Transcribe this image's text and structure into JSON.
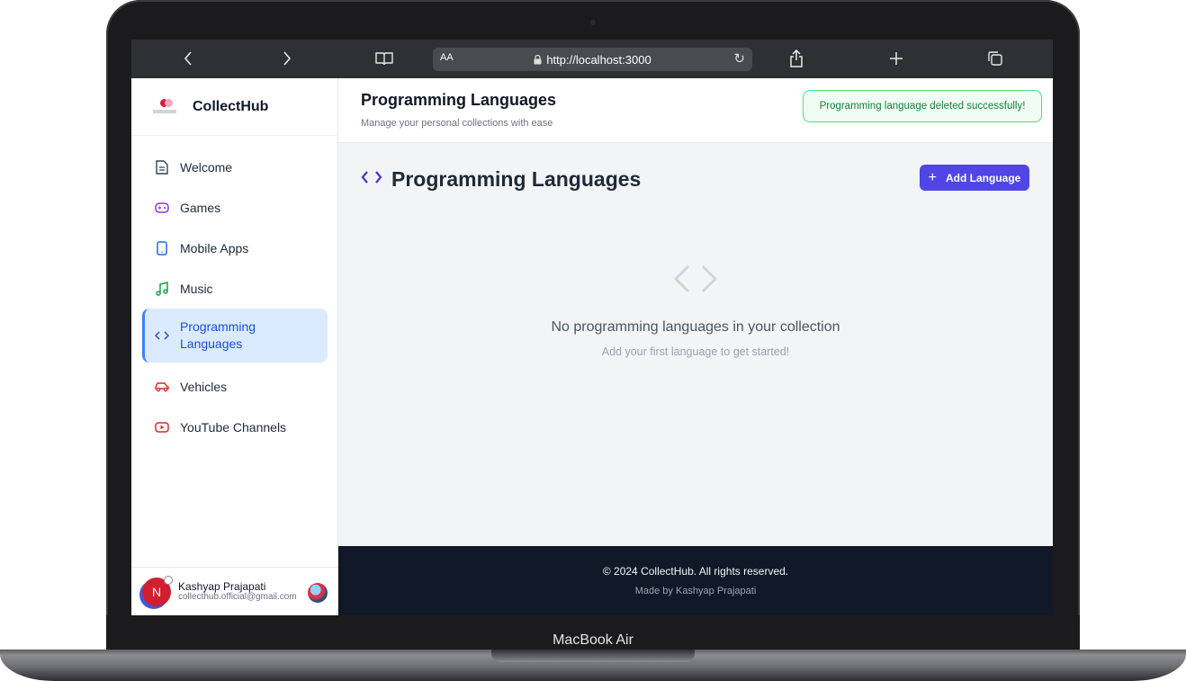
{
  "device": {
    "model_label": "MacBook Air"
  },
  "browser": {
    "reader_label": "AA",
    "url": "http://localhost:3000"
  },
  "app": {
    "brand": "CollectHub",
    "brand_logo_text": "CollectHub",
    "nav": [
      {
        "label": "Welcome",
        "icon": "document-icon",
        "active": false
      },
      {
        "label": "Games",
        "icon": "gamepad-icon",
        "active": false
      },
      {
        "label": "Mobile Apps",
        "icon": "smartphone-icon",
        "active": false
      },
      {
        "label": "Music",
        "icon": "music-note-icon",
        "active": false
      },
      {
        "label": "Programming Languages",
        "icon": "code-icon",
        "active": true
      },
      {
        "label": "Vehicles",
        "icon": "car-icon",
        "active": false
      },
      {
        "label": "YouTube Channels",
        "icon": "youtube-icon",
        "active": false
      }
    ],
    "user": {
      "initial": "N",
      "name": "Kashyap Prajapati",
      "email": "collecthub.official@gmail.com"
    }
  },
  "header": {
    "title": "Programming Languages",
    "subtitle": "Manage your personal collections with ease",
    "toast": "Programming language deleted successfully!"
  },
  "main": {
    "section_title": "Programming Languages",
    "add_button": "Add Language",
    "empty_title": "No programming languages in your collection",
    "empty_subtitle": "Add your first language to get started!"
  },
  "footer": {
    "copyright": "© 2024 CollectHub. All rights reserved.",
    "made_by": "Made by Kashyap Prajapati"
  },
  "colors": {
    "accent": "#4f46e5",
    "active_nav_bg": "#dbeafe",
    "toast_border": "#4ade80",
    "footer_bg": "#111827"
  }
}
